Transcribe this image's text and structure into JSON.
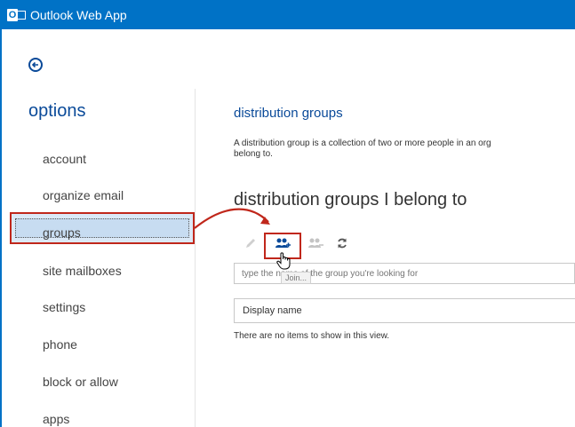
{
  "app": {
    "title": "Outlook Web App",
    "logo_letter": "O"
  },
  "nav": {
    "title": "options",
    "items": [
      {
        "label": "account"
      },
      {
        "label": "organize email"
      },
      {
        "label": "groups",
        "selected": true
      },
      {
        "label": "site mailboxes"
      },
      {
        "label": "settings"
      },
      {
        "label": "phone"
      },
      {
        "label": "block or allow"
      },
      {
        "label": "apps"
      }
    ]
  },
  "main": {
    "section_title": "distribution groups",
    "description_line1": "A distribution group is a collection of two or more people in an org",
    "description_line2": "belong to.",
    "subtitle": "distribution groups I belong to",
    "toolbar": {
      "edit_icon": "pencil-icon",
      "join_icon": "join-group-icon",
      "leave_icon": "leave-group-icon",
      "refresh_icon": "refresh-icon",
      "join_tooltip": "Join..."
    },
    "search": {
      "placeholder": "type the name of the group you're looking for",
      "value": ""
    },
    "table": {
      "columns": [
        "Display name"
      ],
      "empty_message": "There are no items to show in this view."
    }
  },
  "colors": {
    "topbar": "#0072c6",
    "accent": "#0a4a99",
    "highlight_border": "#c0271b",
    "selected_bg": "#c7dcf1"
  }
}
